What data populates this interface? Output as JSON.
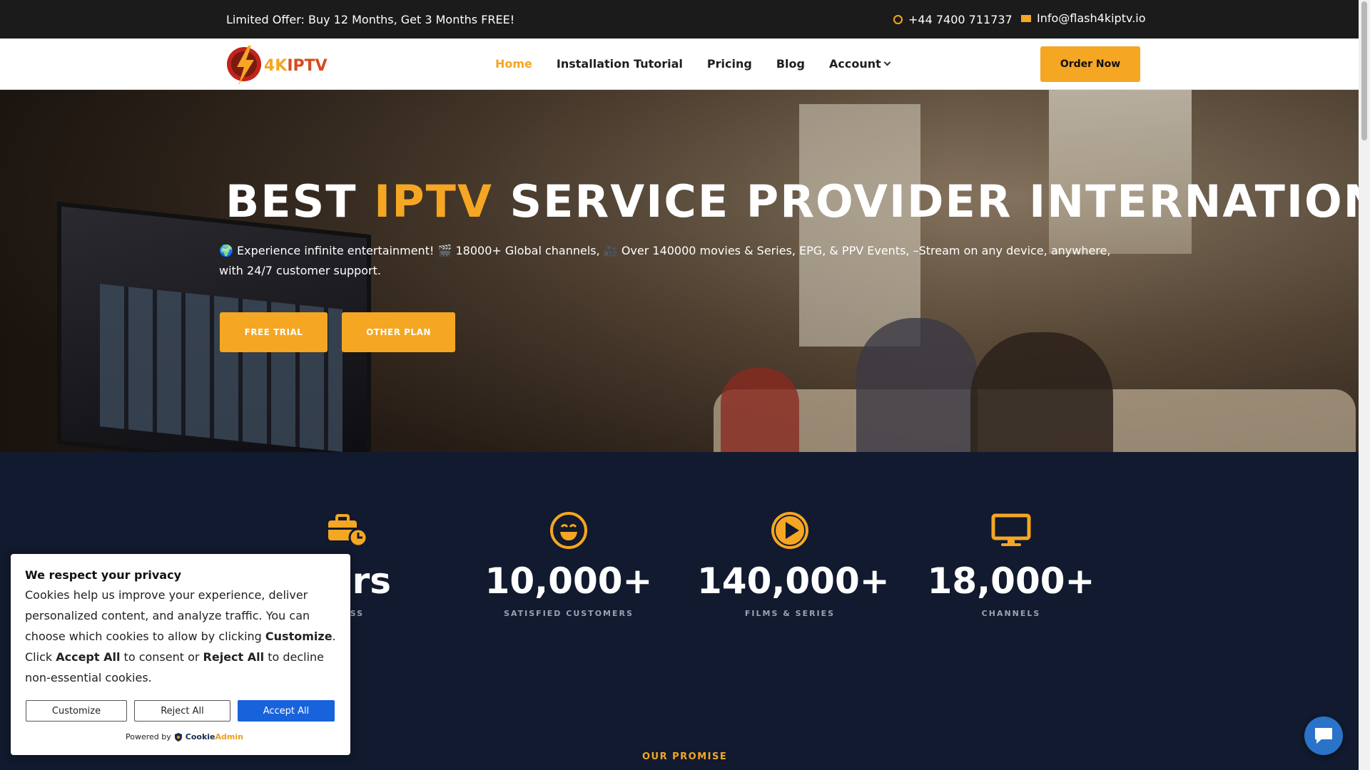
{
  "topbar": {
    "offer": "Limited Offer: Buy 12 Months, Get 3 Months FREE!",
    "phone": "+44 7400 711737",
    "email": "Info@flash4kiptv.io"
  },
  "logo": {
    "part1": "4K",
    "part2": "IPTV"
  },
  "nav": {
    "items": [
      {
        "label": "Home",
        "active": true
      },
      {
        "label": "Installation Tutorial"
      },
      {
        "label": "Pricing"
      },
      {
        "label": "Blog"
      },
      {
        "label": "Account"
      }
    ],
    "order_label": "Order Now"
  },
  "hero": {
    "title_pre": "BEST ",
    "title_hl": "IPTV",
    "title_post": " SERVICE PROVIDER INTERNATIONLLY",
    "description": "🌍 Experience infinite entertainment! 🎬 18000+ Global channels, 🎥 Over 140000 movies & Series, EPG, & PPV Events, –Stream on any device, anywhere, with 24/7 customer support.",
    "btn_trial": "FREE TRIAL",
    "btn_other": "OTHER PLAN"
  },
  "stats": [
    {
      "icon": "briefcase-clock-icon",
      "number": "ears",
      "label": "INESS"
    },
    {
      "icon": "smile-icon",
      "number": "10,000+",
      "label": "SATISFIED CUSTOMERS"
    },
    {
      "icon": "play-icon",
      "number": "140,000+",
      "label": "FILMS & SERIES"
    },
    {
      "icon": "monitor-icon",
      "number": "18,000+",
      "label": "CHANNELS"
    }
  ],
  "promise": "OUR PROMISE",
  "cookie": {
    "title": "We respect your privacy",
    "text1": "Cookies help us improve your experience, deliver personalized content, and analyze traffic. You can choose which cookies to allow by clicking ",
    "bold1": "Customize",
    "text2": ". Click ",
    "bold2": "Accept All",
    "text3": " to consent or ",
    "bold3": "Reject All",
    "text4": " to decline non-essential cookies.",
    "customize": "Customize",
    "reject": "Reject All",
    "accept": "Accept All",
    "powered": "Powered by",
    "brand1": "Cookie",
    "brand2": "Admin"
  },
  "colors": {
    "accent": "#f5a623",
    "dark": "#111a2e",
    "primary_blue": "#1863dc"
  }
}
